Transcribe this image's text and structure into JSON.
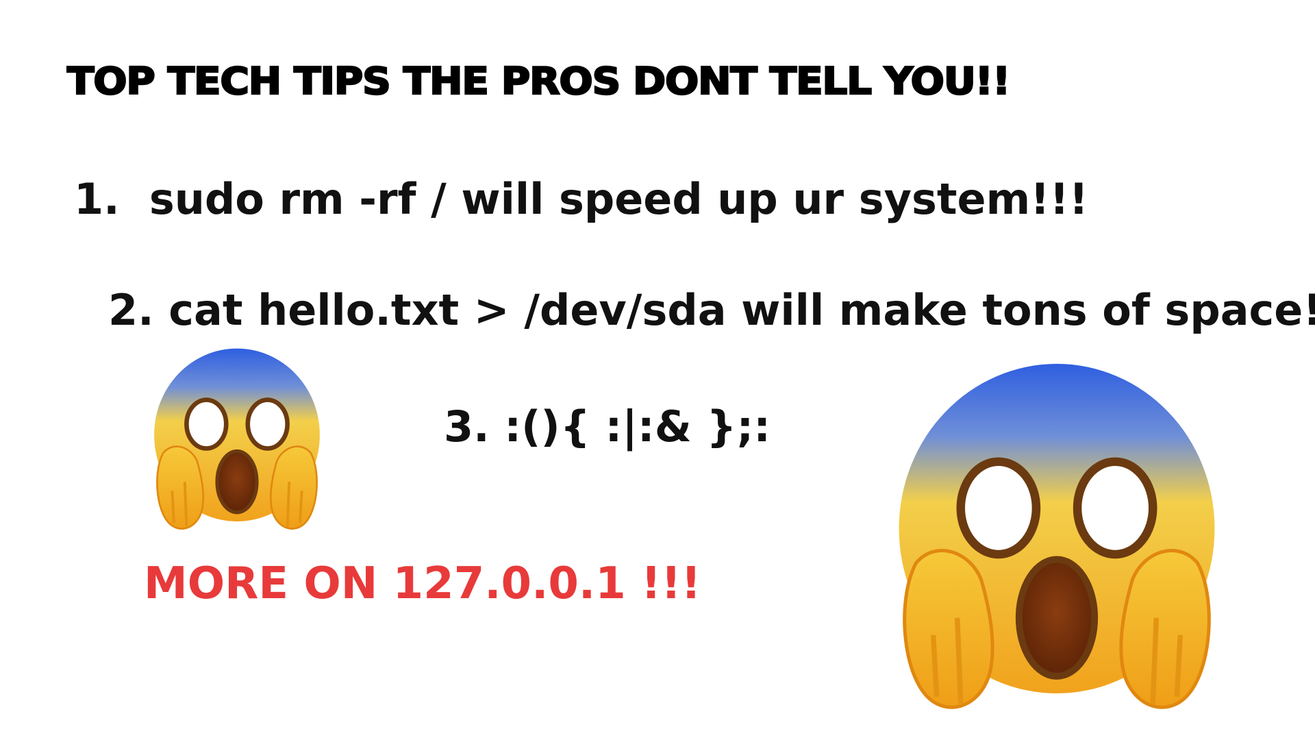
{
  "headline": "TOP TECH TIPS THE PROS DONT TELL YOU!!",
  "tips": [
    "1.  sudo rm -rf / will speed up ur system!!!",
    "2. cat hello.txt > /dev/sda will make tons of space!",
    "3. :(){ :|:& };:"
  ],
  "footer": "MORE ON 127.0.0.1 !!!",
  "emojis": [
    {
      "icon": "face-screaming-in-fear-icon"
    },
    {
      "icon": "face-screaming-in-fear-icon"
    }
  ],
  "colors": {
    "background": "#ffffff",
    "text": "#111111",
    "accent_red": "#e83a3a"
  }
}
